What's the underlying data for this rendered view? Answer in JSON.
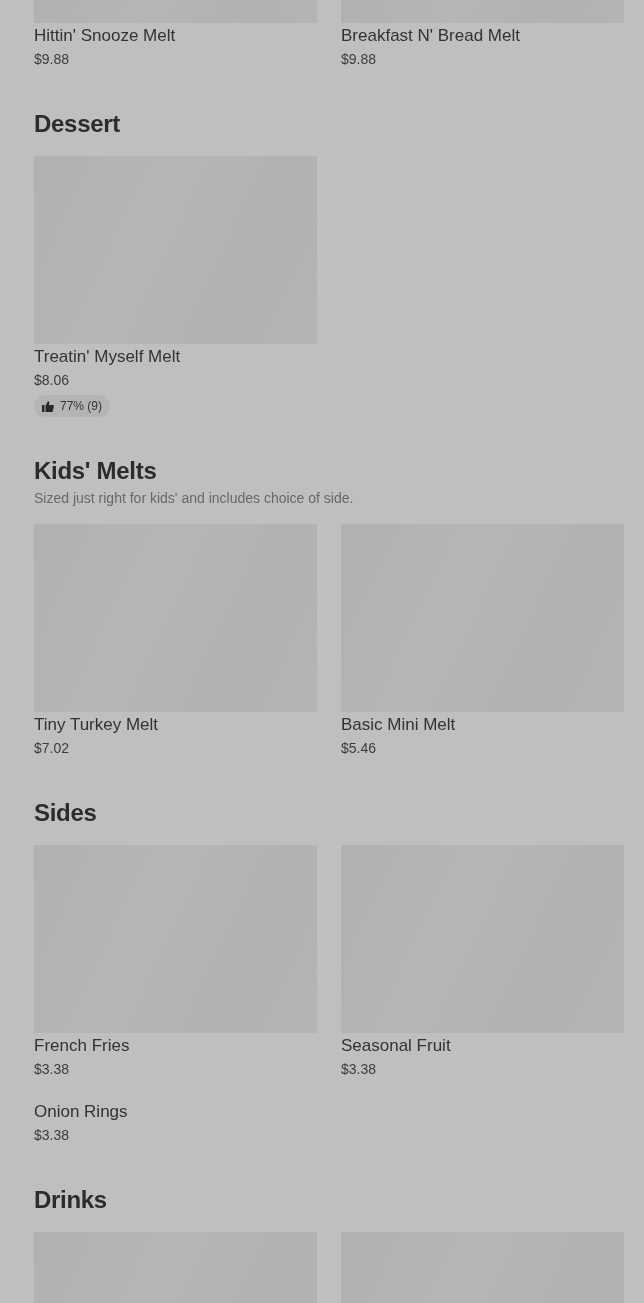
{
  "sections": [
    {
      "items": [
        {
          "name": "Hittin' Snooze Melt",
          "price": "$9.88",
          "has_image": true
        },
        {
          "name": "Breakfast N' Bread Melt",
          "price": "$9.88",
          "has_image": true
        }
      ]
    },
    {
      "title": "Dessert",
      "items": [
        {
          "name": "Treatin' Myself Melt",
          "price": "$8.06",
          "has_image": true,
          "rating": "77% (9)"
        }
      ]
    },
    {
      "title": "Kids' Melts",
      "description": "Sized just right for kids' and includes choice of side.",
      "items": [
        {
          "name": "Tiny Turkey Melt",
          "price": "$7.02",
          "has_image": true
        },
        {
          "name": "Basic Mini Melt",
          "price": "$5.46",
          "has_image": true
        }
      ]
    },
    {
      "title": "Sides",
      "items": [
        {
          "name": "French Fries",
          "price": "$3.38",
          "has_image": true
        },
        {
          "name": "Seasonal Fruit",
          "price": "$3.38",
          "has_image": true
        },
        {
          "name": "Onion Rings",
          "price": "$3.38",
          "has_image": false
        }
      ]
    },
    {
      "title": "Drinks",
      "items": [
        {
          "has_image": true
        },
        {
          "has_image": true
        }
      ]
    }
  ]
}
